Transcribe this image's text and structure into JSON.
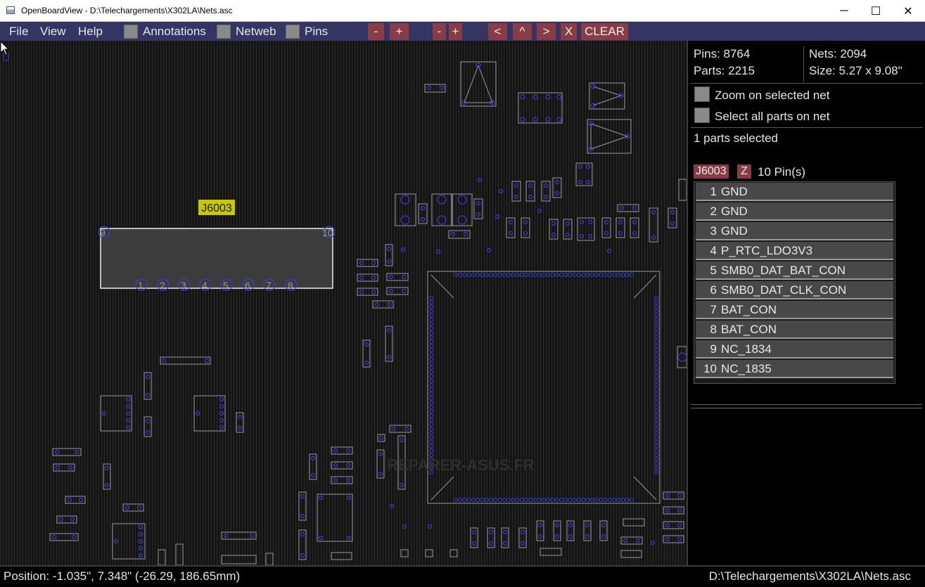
{
  "window": {
    "title": "OpenBoardView - D:\\Telechargements\\X302LA\\Nets.asc",
    "minimize": "─",
    "maximize": "☐",
    "close": "✕"
  },
  "menu": {
    "file": "File",
    "view": "View",
    "help": "Help",
    "annotations": "Annotations",
    "netweb": "Netweb",
    "pins": "Pins"
  },
  "toolbar": {
    "zoom_out_1": "-",
    "zoom_in_1": "+",
    "zoom_out_2": "-",
    "zoom_in_2": "+",
    "left": "<",
    "up": "^",
    "right": ">",
    "x": "X",
    "clear": "CLEAR"
  },
  "board": {
    "part_label": "J6003",
    "pin_labels": [
      "9",
      "10",
      "1",
      "2",
      "3",
      "4",
      "5",
      "6",
      "7",
      "8"
    ],
    "watermark": "REPARER-ASUS.FR"
  },
  "panel": {
    "pins": "Pins: 8764",
    "nets": "Nets: 2094",
    "parts": "Parts: 2215",
    "size": "Size: 5.27 x 9.08\"",
    "zoom_on_net": "Zoom on selected net",
    "select_all_parts": "Select all parts on net",
    "parts_selected": "1 parts selected",
    "part_name": "J6003",
    "z_button": "Z",
    "pin_count": "10 Pin(s)",
    "pins_list": [
      {
        "num": "1",
        "net": "GND"
      },
      {
        "num": "2",
        "net": "GND"
      },
      {
        "num": "3",
        "net": "GND"
      },
      {
        "num": "4",
        "net": "P_RTC_LDO3V3"
      },
      {
        "num": "5",
        "net": "SMB0_DAT_BAT_CON"
      },
      {
        "num": "6",
        "net": "SMB0_DAT_CLK_CON"
      },
      {
        "num": "7",
        "net": "BAT_CON"
      },
      {
        "num": "8",
        "net": "BAT_CON"
      },
      {
        "num": "9",
        "net": "NC_1834"
      },
      {
        "num": "10",
        "net": "NC_1835"
      }
    ]
  },
  "status": {
    "position": "Position: -1.035\", 7.348\" (-26.29, 186.65mm)",
    "file": "D:\\Telechargements\\X302LA\\Nets.asc"
  },
  "colors": {
    "menubar": "#353564",
    "button": "#8a3c46",
    "pad_outline": "#3c3cd8",
    "part_highlight": "#c8c800"
  }
}
